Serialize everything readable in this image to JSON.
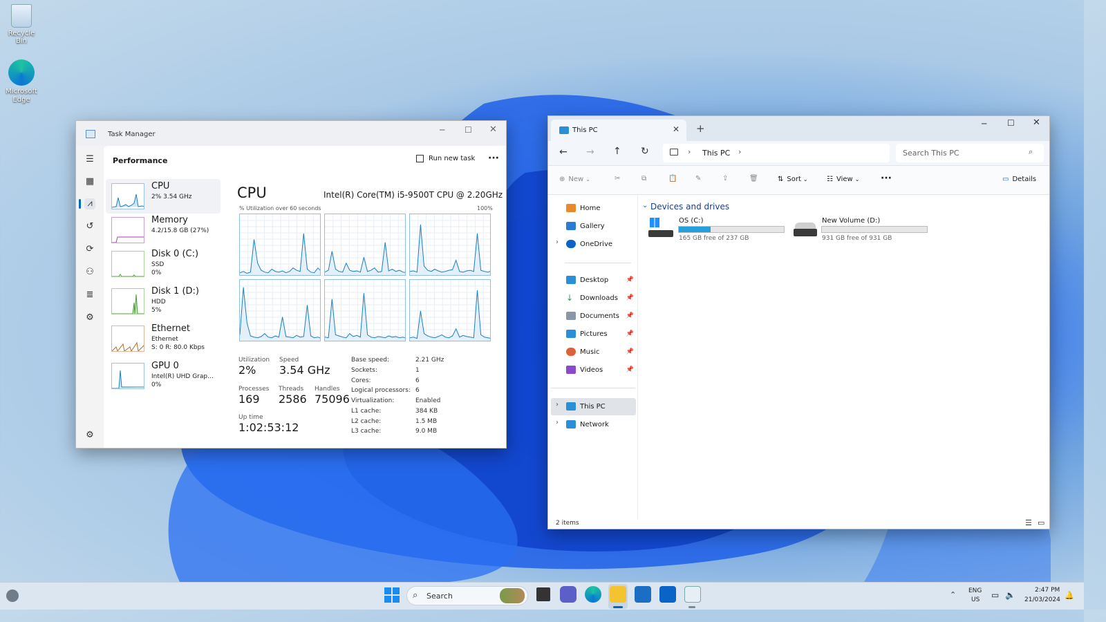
{
  "desktop": {
    "icons": [
      {
        "label": "Recycle Bin"
      },
      {
        "label": "Microsoft Edge"
      }
    ]
  },
  "task_manager": {
    "title": "Task Manager",
    "section": "Performance",
    "run_new_task": "Run new task",
    "more": "···",
    "items": [
      {
        "name": "CPU",
        "sub1": "2% 3.54 GHz",
        "sub2": "",
        "sub3": ""
      },
      {
        "name": "Memory",
        "sub1": "4.2/15.8 GB (27%)",
        "sub2": "",
        "sub3": ""
      },
      {
        "name": "Disk 0 (C:)",
        "sub1": "SSD",
        "sub2": "0%",
        "sub3": ""
      },
      {
        "name": "Disk 1 (D:)",
        "sub1": "HDD",
        "sub2": "5%",
        "sub3": ""
      },
      {
        "name": "Ethernet",
        "sub1": "Ethernet",
        "sub2": "S: 0 R: 80.0 Kbps",
        "sub3": ""
      },
      {
        "name": "GPU 0",
        "sub1": "Intel(R) UHD Grap...",
        "sub2": "0%",
        "sub3": ""
      }
    ],
    "cpu": {
      "heading": "CPU",
      "model": "Intel(R) Core(TM) i5-9500T CPU @ 2.20GHz",
      "graph_label": "% Utilization over 60 seconds",
      "graph_max": "100%",
      "utilization_label": "Utilization",
      "utilization": "2%",
      "speed_label": "Speed",
      "speed": "3.54 GHz",
      "processes_label": "Processes",
      "processes": "169",
      "threads_label": "Threads",
      "threads": "2586",
      "handles_label": "Handles",
      "handles": "75096",
      "uptime_label": "Up time",
      "uptime": "1:02:53:12",
      "specs": [
        {
          "k": "Base speed:",
          "v": "2.21 GHz"
        },
        {
          "k": "Sockets:",
          "v": "1"
        },
        {
          "k": "Cores:",
          "v": "6"
        },
        {
          "k": "Logical processors:",
          "v": "6"
        },
        {
          "k": "Virtualization:",
          "v": "Enabled"
        },
        {
          "k": "L1 cache:",
          "v": "384 KB"
        },
        {
          "k": "L2 cache:",
          "v": "1.5 MB"
        },
        {
          "k": "L3 cache:",
          "v": "9.0 MB"
        }
      ]
    }
  },
  "explorer": {
    "tab_title": "This PC",
    "address": "This PC",
    "search_placeholder": "Search This PC",
    "toolbar": {
      "new": "New",
      "sort": "Sort",
      "view": "View",
      "more": "···",
      "details": "Details"
    },
    "nav": {
      "home": "Home",
      "gallery": "Gallery",
      "onedrive": "OneDrive",
      "desktop": "Desktop",
      "downloads": "Downloads",
      "documents": "Documents",
      "pictures": "Pictures",
      "music": "Music",
      "videos": "Videos",
      "this_pc": "This PC",
      "network": "Network"
    },
    "group_header": "Devices and drives",
    "drives": [
      {
        "name": "OS (C:)",
        "free": "165 GB free of 237 GB",
        "used_fraction": 0.3
      },
      {
        "name": "New Volume (D:)",
        "free": "931 GB free of 931 GB",
        "used_fraction": 0.0
      }
    ],
    "status": "2 items"
  },
  "taskbar": {
    "search": "Search",
    "lang1": "ENG",
    "lang2": "US",
    "time": "2:47 PM",
    "date": "21/03/2024"
  },
  "colors": {
    "accent": "#0067c0",
    "graph_line": "#1a7fc4",
    "drive_bar": "#26a0da"
  }
}
